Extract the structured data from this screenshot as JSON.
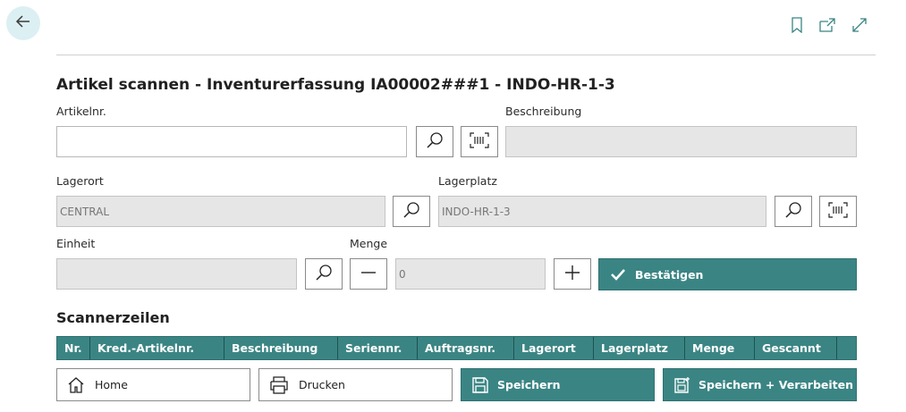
{
  "header": {
    "back_icon": "arrow-left-icon",
    "bookmark_icon": "bookmark-icon",
    "open_new_icon": "open-in-new-icon",
    "expand_icon": "expand-icon"
  },
  "title": "Artikel scannen - Inventurerfassung IA00002###1 - INDO-HR-1-3",
  "fields": {
    "artikelnr_label": "Artikelnr.",
    "artikelnr_value": "",
    "beschreibung_label": "Beschreibung",
    "beschreibung_value": "",
    "lagerort_label": "Lagerort",
    "lagerort_value": "CENTRAL",
    "lagerplatz_label": "Lagerplatz",
    "lagerplatz_value": "INDO-HR-1-3",
    "einheit_label": "Einheit",
    "einheit_value": "",
    "menge_label": "Menge",
    "menge_value": "0"
  },
  "buttons": {
    "confirm_label": "Bestätigen",
    "home_label": "Home",
    "print_label": "Drucken",
    "save_label": "Speichern",
    "save_process_label": "Speichern + Verarbeiten"
  },
  "scanner": {
    "title": "Scannerzeilen",
    "columns": [
      "Nr.",
      "Kred.-Artikelnr.",
      "Beschreibung",
      "Seriennr.",
      "Auftragsnr.",
      "Lagerort",
      "Lagerplatz",
      "Menge",
      "Gescannt"
    ]
  },
  "colors": {
    "accent": "#3a8584",
    "back_bg": "#dceff3",
    "readonly_bg": "#e6e6e6"
  }
}
